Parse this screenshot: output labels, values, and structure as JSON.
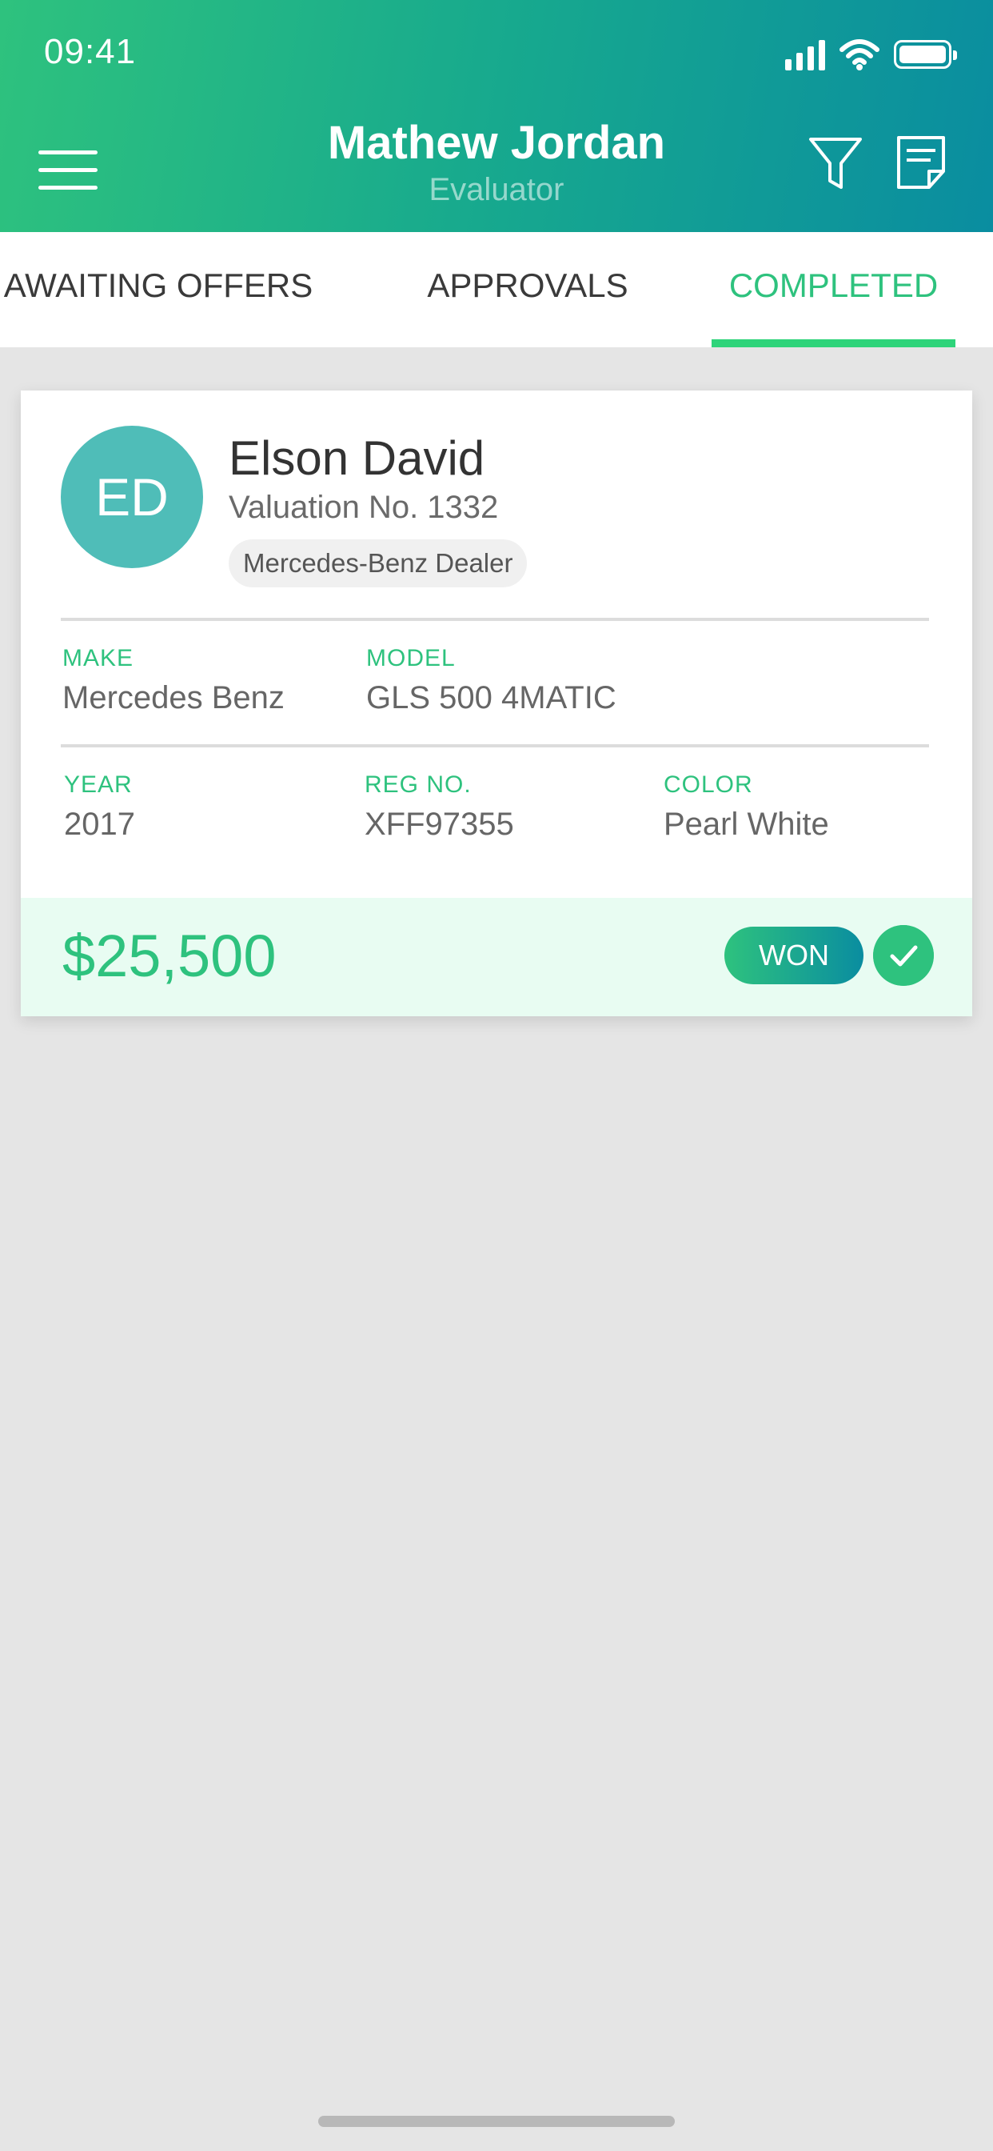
{
  "status_bar": {
    "time": "09:41"
  },
  "header": {
    "title": "Mathew Jordan",
    "subtitle": "Evaluator",
    "icons": [
      "menu-icon",
      "filter-icon",
      "notes-icon"
    ]
  },
  "tabs": [
    {
      "label": "AWAITING OFFERS",
      "active": false
    },
    {
      "label": "APPROVALS",
      "active": false
    },
    {
      "label": "COMPLETED",
      "active": true
    }
  ],
  "colors": {
    "brand_green": "#2ec27e",
    "brand_teal": "#0a8da0",
    "avatar_bg": "#4fbdb8",
    "footer_bg": "#e8fcf2"
  },
  "card": {
    "initials": "ED",
    "name": "Elson David",
    "valuation": "Valuation No. 1332",
    "dealer": "Mercedes-Benz Dealer",
    "fields": {
      "make_label": "MAKE",
      "make_value": "Mercedes Benz",
      "model_label": "MODEL",
      "model_value": "GLS 500 4MATIC",
      "year_label": "YEAR",
      "year_value": "2017",
      "reg_label": "REG NO.",
      "reg_value": "XFF97355",
      "color_label": "COLOR",
      "color_value": "Pearl White"
    },
    "price": "$25,500",
    "status": "WON"
  }
}
